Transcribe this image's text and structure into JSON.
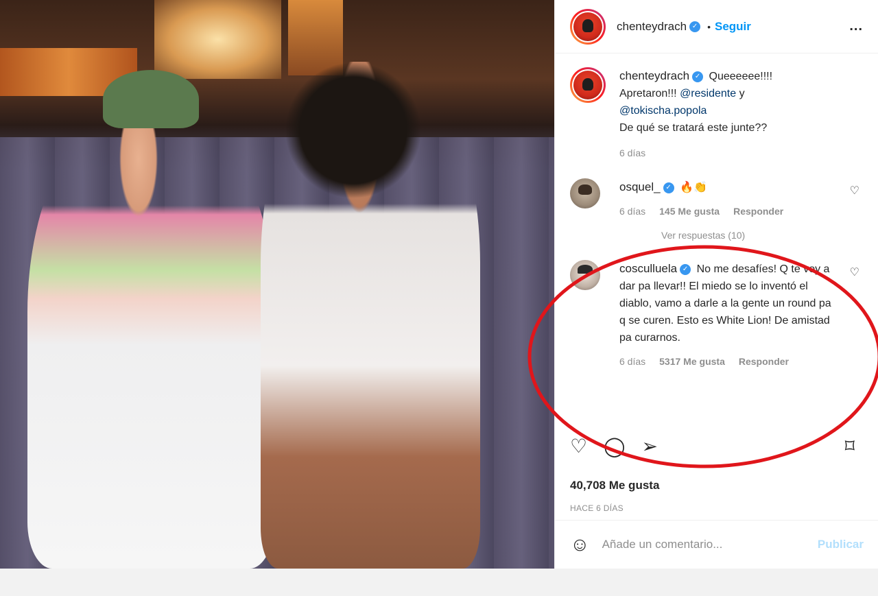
{
  "post": {
    "author": "chenteydrach",
    "follow_label": "Seguir",
    "separator": "•",
    "more_label": "...",
    "caption": {
      "author": "chenteydrach",
      "text_1": "Queeeeee!!!!",
      "text_2": "Apretaron!!!",
      "mention_1": "@residente",
      "and": "y",
      "mention_2": "@tokischa.popola",
      "text_3": "De qué se tratará este junte??",
      "time": "6 días"
    },
    "comments": [
      {
        "author": "osquel_",
        "text": "🔥👏",
        "time": "6 días",
        "likes": "145 Me gusta",
        "reply": "Responder",
        "view_replies": "Ver respuestas (10)"
      },
      {
        "author": "cosculluela",
        "text": "No me desafíes! Q te voy a dar pa llevar!! El miedo se lo inventó el diablo, vamo a darle a la gente un round pa q se curen. Esto es White Lion! De amistad pa curarnos.",
        "time": "6 días",
        "likes": "5317 Me gusta",
        "reply": "Responder"
      }
    ],
    "likes_total": "40,708 Me gusta",
    "date": "HACE 6 DÍAS",
    "add_comment_placeholder": "Añade un comentario...",
    "publish_label": "Publicar"
  },
  "icons": {
    "verified": "✓",
    "heart": "♡",
    "comment": "◯",
    "share": "➢",
    "save": "⌑",
    "emoji": "☺"
  },
  "colors": {
    "accent_blue": "#0095f6",
    "verified_blue": "#3897f0",
    "highlight_red": "#e0161b",
    "publish_disabled": "#b2dffc"
  }
}
